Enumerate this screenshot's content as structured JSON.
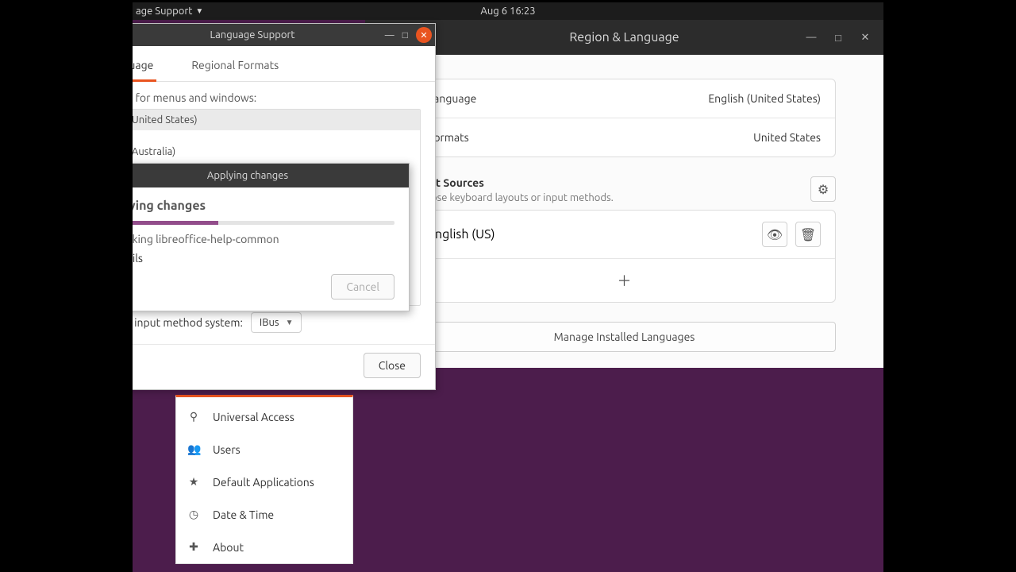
{
  "topbar": {
    "app_menu": "age Support",
    "time": "Aug 6  16:23"
  },
  "region_window": {
    "title": "Region & Language",
    "rows": {
      "language_label": "Language",
      "language_value": "English (United States)",
      "formats_label": "Formats",
      "formats_value": "United States"
    },
    "input_sources": {
      "heading": "Input Sources",
      "subtext": "Choose keyboard layouts or input methods.",
      "item": "English (US)"
    },
    "manage_btn": "Manage Installed Languages"
  },
  "lang_window": {
    "title": "Language Support",
    "tabs": {
      "lang": "Language",
      "regional": "Regional Formats"
    },
    "desc": "Language for menus and windows:",
    "langs": {
      "en_us": "English (United States)",
      "en_au": "English (Australia)"
    },
    "kb_label": "Keyboard input method system:",
    "kb_value": "IBus",
    "close_btn": "Close"
  },
  "apply_dialog": {
    "header": "Applying changes",
    "heading": "Applying changes",
    "status": "Unpacking libreoffice-help-common",
    "details": "Details",
    "cancel": "Cancel"
  },
  "sidebar": {
    "items": [
      {
        "icon": "person-stand",
        "glyph": "⚲",
        "label": "Universal Access"
      },
      {
        "icon": "users",
        "glyph": "👥",
        "label": "Users"
      },
      {
        "icon": "star",
        "glyph": "★",
        "label": "Default Applications"
      },
      {
        "icon": "clock",
        "glyph": "◷",
        "label": "Date & Time"
      },
      {
        "icon": "plus",
        "glyph": "✚",
        "label": "About"
      }
    ]
  }
}
